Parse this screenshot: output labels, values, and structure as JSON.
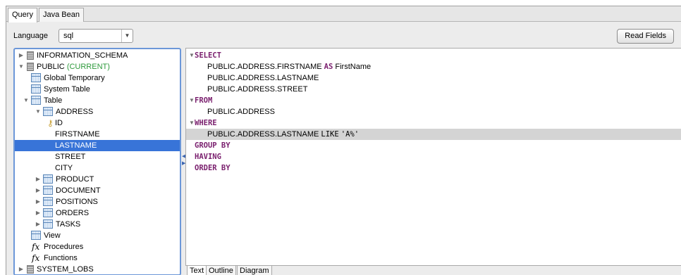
{
  "tabs": [
    {
      "label": "Query",
      "active": true
    },
    {
      "label": "Java Bean",
      "active": false
    }
  ],
  "language": {
    "label": "Language",
    "value": "sql"
  },
  "read_fields_label": "Read Fields",
  "tree": {
    "information_schema": "INFORMATION_SCHEMA",
    "public": "PUBLIC",
    "current": "(CURRENT)",
    "global_temporary": "Global Temporary",
    "system_table": "System Table",
    "table": "Table",
    "address": "ADDRESS",
    "id": "ID",
    "firstname": "FIRSTNAME",
    "lastname": "LASTNAME",
    "street": "STREET",
    "city": "CITY",
    "product": "PRODUCT",
    "document": "DOCUMENT",
    "positions": "POSITIONS",
    "orders": "ORDERS",
    "tasks": "TASKS",
    "view": "View",
    "procedures": "Procedures",
    "functions": "Functions",
    "system_lobs": "SYSTEM_LOBS",
    "selected": "LASTNAME"
  },
  "sql": {
    "select": "SELECT",
    "sel1": "PUBLIC.ADDRESS.FIRSTNAME",
    "as": "AS",
    "alias": "FirstName",
    "sel2": "PUBLIC.ADDRESS.LASTNAME",
    "sel3": "PUBLIC.ADDRESS.STREET",
    "from": "FROM",
    "from1": "PUBLIC.ADDRESS",
    "where": "WHERE",
    "where_col": "PUBLIC.ADDRESS.LASTNAME",
    "like": "LIKE",
    "pattern": "'A%'",
    "group_by": "GROUP BY",
    "having": "HAVING",
    "order_by": "ORDER BY"
  },
  "bottom_tabs": [
    {
      "label": "Text",
      "active": true
    },
    {
      "label": "Outline",
      "active": false
    },
    {
      "label": "Diagram",
      "active": false
    }
  ]
}
